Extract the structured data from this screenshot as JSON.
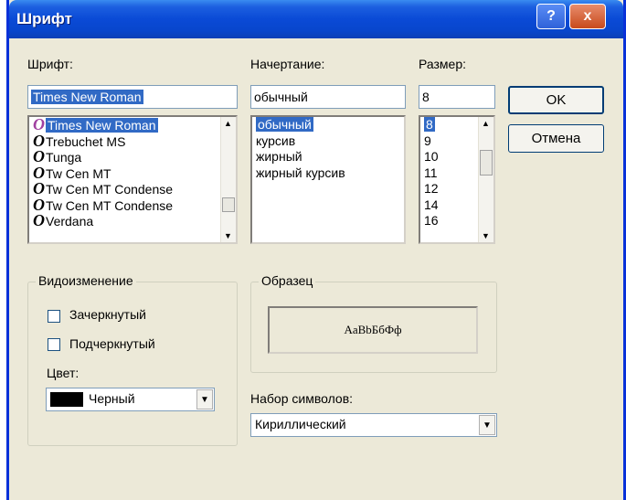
{
  "window": {
    "title": "Шрифт",
    "help": "?",
    "close": "x"
  },
  "font": {
    "label": "Шрифт:",
    "value": "Times New Roman",
    "items": [
      {
        "icon": "O",
        "label": "Times New Roman"
      },
      {
        "icon": "O",
        "label": "Trebuchet MS"
      },
      {
        "icon": "O",
        "label": "Tunga"
      },
      {
        "icon": "O",
        "label": "Tw Cen MT"
      },
      {
        "icon": "O",
        "label": "Tw Cen MT Condense"
      },
      {
        "icon": "O",
        "label": "Tw Cen MT Condense"
      },
      {
        "icon": "O",
        "label": "Verdana"
      }
    ],
    "selected_index": 0
  },
  "style": {
    "label": "Начертание:",
    "value": "обычный",
    "items": [
      "обычный",
      "курсив",
      "жирный",
      "жирный курсив"
    ],
    "selected_index": 0
  },
  "size": {
    "label": "Размер:",
    "value": "8",
    "items": [
      "8",
      "9",
      "10",
      "11",
      "12",
      "14",
      "16"
    ],
    "selected_index": 0
  },
  "buttons": {
    "ok": "OK",
    "cancel": "Отмена"
  },
  "effects": {
    "title": "Видоизменение",
    "strikeout": "Зачеркнутый",
    "underline": "Подчеркнутый",
    "color_label": "Цвет:",
    "color_value": "Черный",
    "color_swatch": "#000000"
  },
  "sample": {
    "title": "Образец",
    "text": "AaBbБбФф"
  },
  "charset": {
    "label": "Набор символов:",
    "value": "Кириллический"
  },
  "colors": {
    "titlebar": "#0a4ad6",
    "selection": "#316ac5",
    "dialog_bg": "#ece9d8"
  }
}
